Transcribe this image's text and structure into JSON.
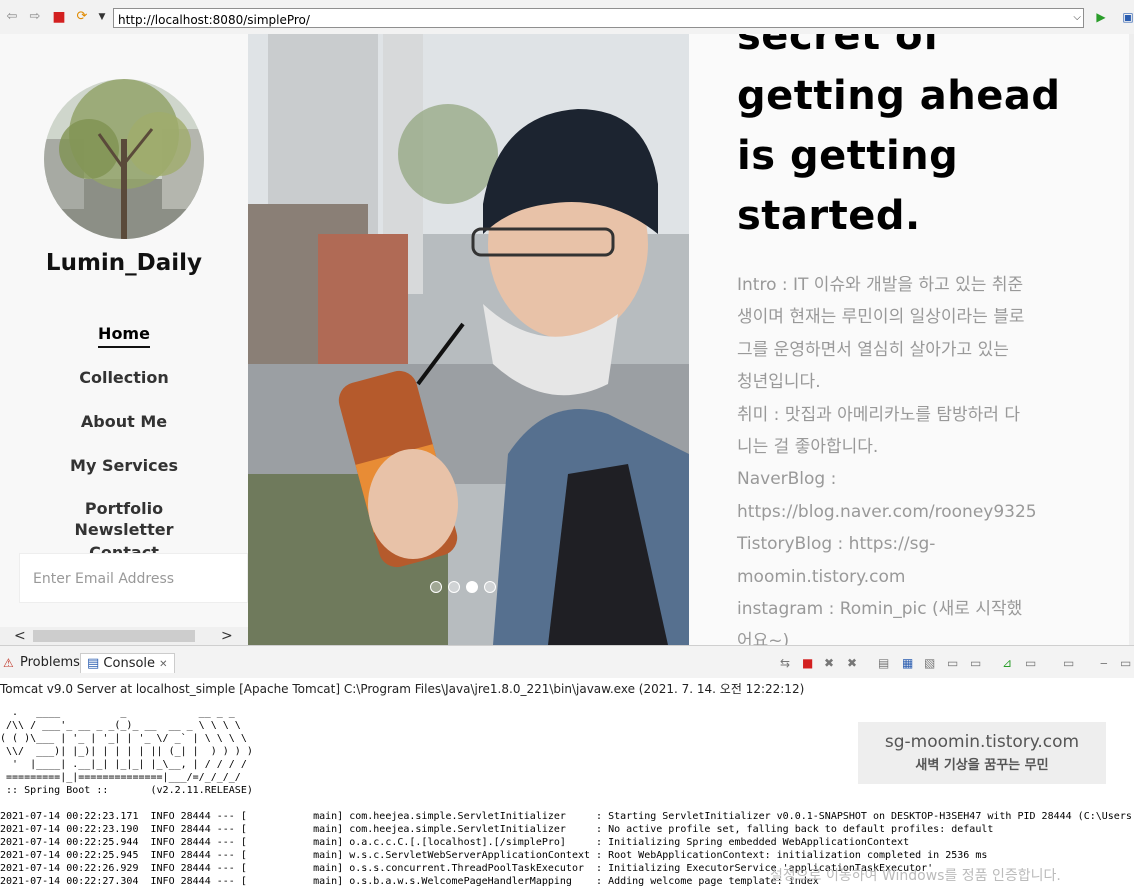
{
  "browser": {
    "url": "http://localhost:8080/simplePro/"
  },
  "sidebar": {
    "brand": "Lumin_Daily",
    "nav": [
      "Home",
      "Collection",
      "About Me",
      "My Services",
      "Portfolio",
      "Newsletter",
      "Contact"
    ],
    "active_index": 0,
    "email_placeholder": "Enter Email Address"
  },
  "slider": {
    "dot_count": 4,
    "active_dot": 2
  },
  "content": {
    "headline_lines": [
      "secret of",
      "getting ahead",
      "is getting",
      "started."
    ],
    "intro_lines": [
      "Intro : IT 이슈와 개발을 하고 있는 취준",
      "생이며 현재는 루민이의 일상이라는 블로",
      "그를 운영하면서 열심히 살아가고 있는",
      "청년입니다.",
      "취미 : 맛집과 아메리카노를 탐방하러 다",
      "니는 걸 좋아합니다.",
      "NaverBlog :",
      "https://blog.naver.com/rooney9325",
      "TistoryBlog : https://sg-",
      "moomin.tistory.com",
      "instagram : Romin_pic (새로 시작했",
      "어요~)"
    ]
  },
  "eclipse": {
    "tab_problems": "Problems",
    "tab_console": "Console",
    "launch_line": "Tomcat v9.0 Server at localhost_simple [Apache Tomcat] C:\\Program Files\\Java\\jre1.8.0_221\\bin\\javaw.exe (2021. 7. 14. 오전 12:22:12)",
    "banner": "  .   ____          _            __ _ _\n /\\\\ / ___'_ __ _ _(_)_ __  __ _ \\ \\ \\ \\\n( ( )\\___ | '_ | '_| | '_ \\/ _` | \\ \\ \\ \\\n \\\\/  ___)| |_)| | | | | || (_| |  ) ) ) )\n  '  |____| .__|_| |_|_| |_\\__, | / / / /\n =========|_|==============|___/=/_/_/_/\n :: Spring Boot ::       (v2.2.11.RELEASE)",
    "log_lines": [
      "2021-07-14 00:22:23.171  INFO 28444 --- [           main] com.heejea.simple.ServletInitializer     : Starting ServletInitializer v0.0.1-SNAPSHOT on DESKTOP-H3SEH47 with PID 28444 (C:\\Users",
      "2021-07-14 00:22:23.190  INFO 28444 --- [           main] com.heejea.simple.ServletInitializer     : No active profile set, falling back to default profiles: default",
      "2021-07-14 00:22:25.944  INFO 28444 --- [           main] o.a.c.c.C.[.[localhost].[/simplePro]     : Initializing Spring embedded WebApplicationContext",
      "2021-07-14 00:22:25.945  INFO 28444 --- [           main] w.s.c.ServletWebServerApplicationContext : Root WebApplicationContext: initialization completed in 2536 ms",
      "2021-07-14 00:22:26.929  INFO 28444 --- [           main] o.s.s.concurrent.ThreadPoolTaskExecutor  : Initializing ExecutorService 'applicationTaskExecutor'",
      "2021-07-14 00:22:27.304  INFO 28444 --- [           main] o.s.b.a.w.s.WelcomePageHandlerMapping    : Adding welcome page template: index"
    ],
    "watermark_title": "sg-moomin.tistory.com",
    "watermark_sub": "새벽 기상을 꿈꾸는 무민",
    "windows_watermark": "설정으로 이동하여 Windows를 정품 인증합니다."
  }
}
